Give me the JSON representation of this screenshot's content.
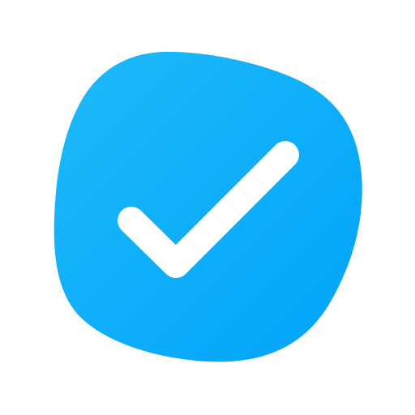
{
  "icon": {
    "name": "checkmark-icon",
    "shape": "rounded-squircle-tilted",
    "colors": {
      "background": "#ffffff",
      "gradient_start": "#1fbaf8",
      "gradient_end": "#00a3fb",
      "check": "#ffffff"
    }
  }
}
